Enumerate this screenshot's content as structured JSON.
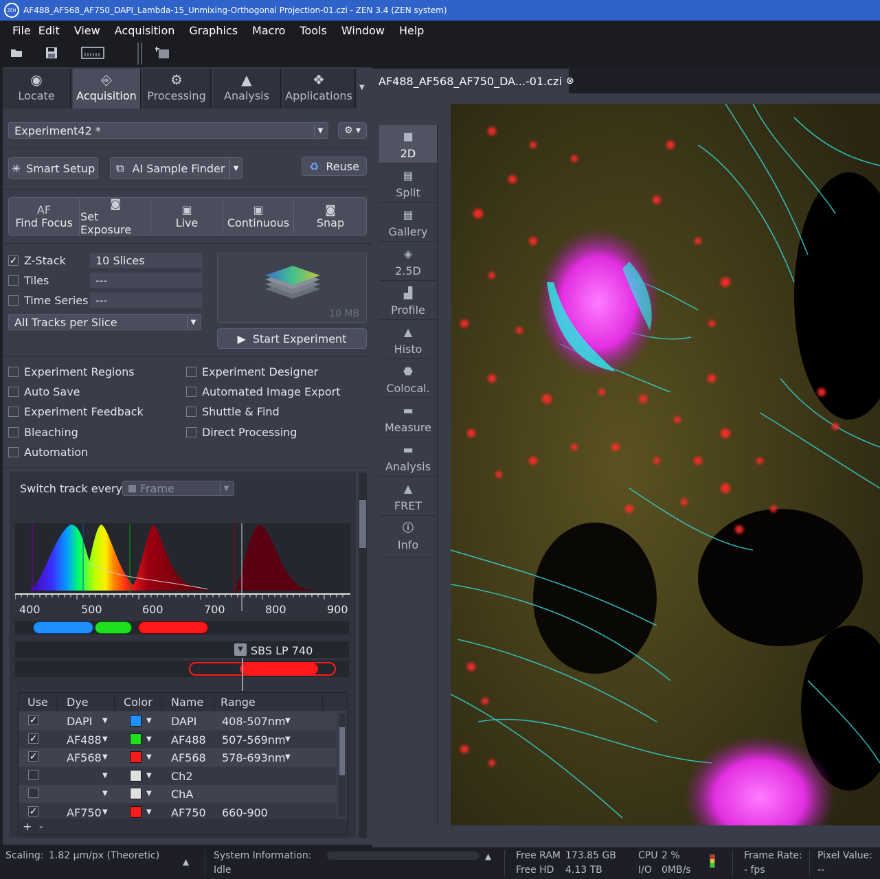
{
  "window": {
    "title": "AF488_AF568_AF750_DAPI_Lambda-15_Unmixing-Orthogonal Projection-01.czi - ZEN 3.4 (ZEN system)",
    "logo": "ZEN"
  },
  "menu": [
    "File",
    "Edit",
    "View",
    "Acquisition",
    "Graphics",
    "Macro",
    "Tools",
    "Window",
    "Help"
  ],
  "tabs": [
    "Locate",
    "Acquisition",
    "Processing",
    "Analysis",
    "Applications"
  ],
  "experiment": {
    "name": "Experiment42 *"
  },
  "buttons": {
    "smart_setup": "Smart Setup",
    "ai_sample_finder": "AI Sample Finder",
    "reuse": "Reuse",
    "af_icon": "AF",
    "find_focus": "Find Focus",
    "set_exposure": "Set Exposure",
    "live": "Live",
    "continuous": "Continuous",
    "snap": "Snap",
    "start_experiment": "Start Experiment"
  },
  "dimensions": {
    "zstack": {
      "label": "Z-Stack",
      "value": "10 Slices",
      "checked": true
    },
    "tiles": {
      "label": "Tiles",
      "value": "---",
      "checked": false
    },
    "time_series": {
      "label": "Time Series",
      "value": "---",
      "checked": false
    },
    "tracks_mode": "All Tracks per Slice",
    "size": "10 MB"
  },
  "options_left": [
    "Experiment Regions",
    "Auto Save",
    "Experiment Feedback",
    "Bleaching",
    "Automation"
  ],
  "options_right": [
    "Experiment Designer",
    "Automated Image Export",
    "Shuttle & Find",
    "Direct Processing"
  ],
  "track": {
    "label": "Switch track every",
    "mode": "Frame"
  },
  "spectrum": {
    "ticks": [
      "400",
      "500",
      "600",
      "700",
      "800",
      "900"
    ],
    "filter": "SBS LP 740"
  },
  "table": {
    "headers": [
      "Use",
      "Dye",
      "Color",
      "Name",
      "Range"
    ],
    "rows": [
      {
        "use": true,
        "dye": "DAPI",
        "color": "#1e90ff",
        "name": "DAPI",
        "range": "408-507nm"
      },
      {
        "use": true,
        "dye": "AF488",
        "color": "#1fe01f",
        "name": "AF488",
        "range": "507-569nm"
      },
      {
        "use": true,
        "dye": "AF568",
        "color": "#ff1a1a",
        "name": "AF568",
        "range": "578-693nm"
      },
      {
        "use": false,
        "dye": "",
        "color": "#e0e0e0",
        "name": "Ch2",
        "range": ""
      },
      {
        "use": false,
        "dye": "",
        "color": "#e0e0e0",
        "name": "ChA",
        "range": ""
      },
      {
        "use": true,
        "dye": "AF750",
        "color": "#ff1a1a",
        "name": "AF750",
        "range": "660-900"
      }
    ],
    "add": "+",
    "remove": "-"
  },
  "document_tab": "AF488_AF568_AF750_DA...-01.czi",
  "view_buttons": [
    "2D",
    "Split",
    "Gallery",
    "2.5D",
    "Profile",
    "Histo",
    "Colocal.",
    "Measure",
    "Analysis",
    "FRET",
    "Info"
  ],
  "status": {
    "scaling_label": "Scaling:",
    "scaling_value": "1.82 µm/px (Theoretic)",
    "sysinfo_label": "System Information:",
    "sysinfo_value": "Idle",
    "free_ram_label": "Free RAM",
    "free_ram_value": "173.85 GB",
    "free_hd_label": "Free HD",
    "free_hd_value": "4.13 TB",
    "cpu_label": "CPU",
    "cpu_value": "2 %",
    "io_label": "I/O",
    "io_value": "0MB/s",
    "frame_rate_label": "Frame Rate:",
    "frame_rate_value": "- fps",
    "pixel_value_label": "Pixel Value:",
    "pixel_value_value": "--"
  }
}
